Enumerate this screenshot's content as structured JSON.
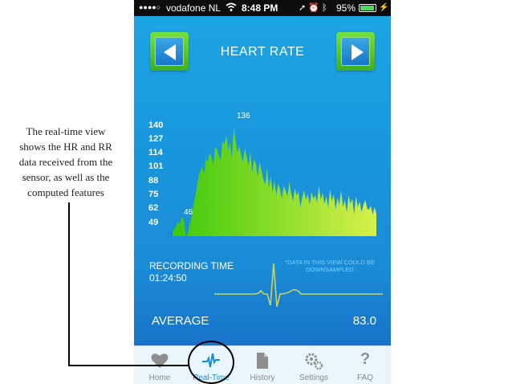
{
  "annotation": {
    "lines": [
      "The real-time view",
      "shows the HR and RR",
      "data received from the",
      "sensor, as well as the",
      "computed features"
    ]
  },
  "status_bar": {
    "signal": "●●●●○",
    "carrier": "vodafone NL",
    "time": "8:48 PM",
    "battery_percent": "95%",
    "battery_level": 0.95,
    "wifi_icon": "wifi-icon",
    "icons": [
      "location-icon",
      "alarm-icon",
      "bluetooth-icon"
    ]
  },
  "header": {
    "title": "HEART RATE",
    "prev_icon": "arrow-left-icon",
    "next_icon": "arrow-right-icon"
  },
  "chart_data": {
    "type": "area",
    "y_ticks": [
      "140",
      "127",
      "114",
      "101",
      "88",
      "75",
      "62",
      "49"
    ],
    "ylim": [
      49,
      140
    ],
    "max_label": "136",
    "min_label": "46",
    "max_value": 136,
    "min_value": 46,
    "values": [
      50,
      52,
      55,
      58,
      56,
      62,
      60,
      48,
      46,
      55,
      60,
      70,
      78,
      85,
      95,
      100,
      104,
      98,
      110,
      108,
      115,
      112,
      105,
      120,
      118,
      113,
      109,
      125,
      122,
      130,
      117,
      124,
      111,
      136,
      126,
      115,
      121,
      113,
      108,
      119,
      112,
      104,
      116,
      99,
      110,
      106,
      95,
      108,
      100,
      93,
      89,
      102,
      86,
      96,
      82,
      92,
      80,
      90,
      85,
      77,
      88,
      84,
      79,
      91,
      82,
      75,
      86,
      80,
      83,
      70,
      78,
      84,
      76,
      81,
      72,
      83,
      77,
      80,
      74,
      88,
      76,
      82,
      73,
      79,
      70,
      85,
      75,
      81,
      68,
      78,
      72,
      84,
      70,
      76,
      66,
      80,
      73,
      77,
      64,
      79,
      70,
      75,
      66,
      72,
      76,
      69,
      68,
      71,
      64,
      70,
      65
    ],
    "color_start": "#3cc80c",
    "color_end": "#d8f04a"
  },
  "recording": {
    "label": "RECORDING TIME",
    "value": "01:24:50",
    "note": "*DATA IN THIS VIEW COULD BE DOWNSAMPLED"
  },
  "average": {
    "label": "AVERAGE",
    "value": "83.0"
  },
  "tabs": [
    {
      "label": "Home",
      "icon": "heart-icon",
      "active": false
    },
    {
      "label": "Real-Time",
      "icon": "pulse-icon",
      "active": true
    },
    {
      "label": "History",
      "icon": "document-icon",
      "active": false
    },
    {
      "label": "Settings",
      "icon": "gears-icon",
      "active": false
    },
    {
      "label": "FAQ",
      "icon": "question-icon",
      "active": false
    }
  ],
  "colors": {
    "accent": "#1a8bd6",
    "button_green": "#5ccb2e",
    "ecg_line": "#c9d35a"
  }
}
